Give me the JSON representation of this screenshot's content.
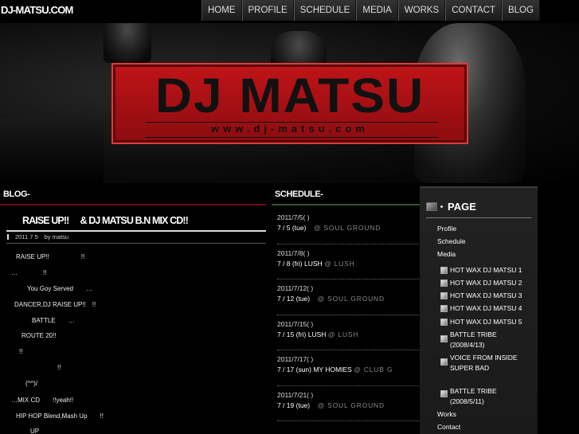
{
  "site_title": "DJ-MATSU.COM",
  "nav": [
    "HOME",
    "PROFILE",
    "SCHEDULE",
    "MEDIA",
    "WORKS",
    "CONTACT",
    "BLOG"
  ],
  "banner": {
    "logo_text": "DJ MATSU",
    "logo_url": "www.dj-matsu.com"
  },
  "blog": {
    "heading": "BLOG-",
    "post_title": "RAISE UP!!　 & DJ MATSU B.N MIX CD!!",
    "post_date": "2011 7 5",
    "post_author": "by matsu",
    "lines": [
      "RAISE UP!!　　　　　!!",
      "…　　　　!!",
      "You Goy Served　　…",
      "DANCER,DJ RAISE UP!!　!!",
      "BATTLE　　…",
      "ROUTE 20!!",
      "!!",
      "!!",
      "(^^)/",
      "…MIX CD　　!!yeah!!",
      "HIP HOP Blend,Mash Up　　!!",
      "UP"
    ]
  },
  "schedule": {
    "heading": "SCHEDULE-",
    "items": [
      {
        "date": "2011/7/5( )",
        "event": "7 / 5 (tue)",
        "venue": "@ SOUL GROUND"
      },
      {
        "date": "2011/7/8( )",
        "event": "7 / 8 (fri)   LUSH",
        "venue": "@ LUSH"
      },
      {
        "date": "2011/7/12( )",
        "event": "7 / 12 (tue)",
        "venue": "@ SOUL GROUND"
      },
      {
        "date": "2011/7/15( )",
        "event": "7 / 15 (fri)   LUSH",
        "venue": "@ LUSH"
      },
      {
        "date": "2011/7/17( )",
        "event": "7 / 17 (sun) MY HOMIES",
        "venue": "@ CLUB G"
      },
      {
        "date": "2011/7/21( )",
        "event": "7 / 19 (tue)",
        "venue": "@ SOUL GROUND"
      }
    ]
  },
  "sidebar": {
    "heading": "PAGE",
    "links": [
      "Profile",
      "Schedule",
      "Media"
    ],
    "media_items": [
      "HOT WAX DJ MATSU 1",
      "HOT WAX DJ MATSU 2",
      "HOT WAX DJ MATSU 3",
      "HOT WAX DJ MATSU 4",
      "HOT WAX DJ MATSU 5",
      "BATTLE TRIBE (2008/4/13)",
      "VOICE FROM INSIDE SUPER BAD",
      "BATTLE TRIBE (2008/5/11)"
    ],
    "bottom_links": [
      "Works",
      "Contact"
    ]
  }
}
